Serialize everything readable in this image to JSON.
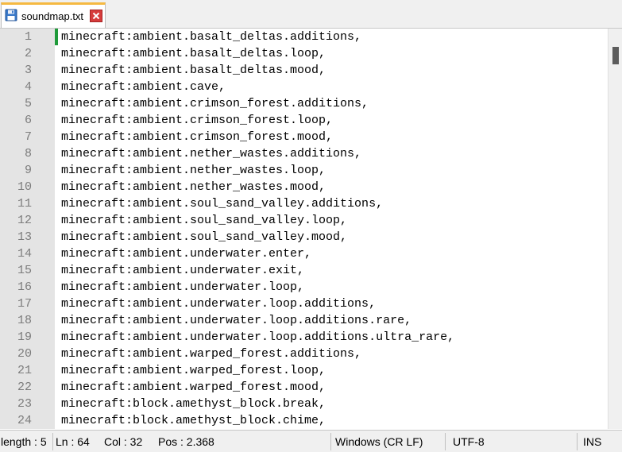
{
  "tab": {
    "filename": "soundmap.txt",
    "icon": "save-disk-icon",
    "close_icon": "close-icon"
  },
  "editor": {
    "lines": [
      {
        "n": "1",
        "text": "minecraft:ambient.basalt_deltas.additions,"
      },
      {
        "n": "2",
        "text": "minecraft:ambient.basalt_deltas.loop,"
      },
      {
        "n": "3",
        "text": "minecraft:ambient.basalt_deltas.mood,"
      },
      {
        "n": "4",
        "text": "minecraft:ambient.cave,"
      },
      {
        "n": "5",
        "text": "minecraft:ambient.crimson_forest.additions,"
      },
      {
        "n": "6",
        "text": "minecraft:ambient.crimson_forest.loop,"
      },
      {
        "n": "7",
        "text": "minecraft:ambient.crimson_forest.mood,"
      },
      {
        "n": "8",
        "text": "minecraft:ambient.nether_wastes.additions,"
      },
      {
        "n": "9",
        "text": "minecraft:ambient.nether_wastes.loop,"
      },
      {
        "n": "10",
        "text": "minecraft:ambient.nether_wastes.mood,"
      },
      {
        "n": "11",
        "text": "minecraft:ambient.soul_sand_valley.additions,"
      },
      {
        "n": "12",
        "text": "minecraft:ambient.soul_sand_valley.loop,"
      },
      {
        "n": "13",
        "text": "minecraft:ambient.soul_sand_valley.mood,"
      },
      {
        "n": "14",
        "text": "minecraft:ambient.underwater.enter,"
      },
      {
        "n": "15",
        "text": "minecraft:ambient.underwater.exit,"
      },
      {
        "n": "16",
        "text": "minecraft:ambient.underwater.loop,"
      },
      {
        "n": "17",
        "text": "minecraft:ambient.underwater.loop.additions,"
      },
      {
        "n": "18",
        "text": "minecraft:ambient.underwater.loop.additions.rare,"
      },
      {
        "n": "19",
        "text": "minecraft:ambient.underwater.loop.additions.ultra_rare,"
      },
      {
        "n": "20",
        "text": "minecraft:ambient.warped_forest.additions,"
      },
      {
        "n": "21",
        "text": "minecraft:ambient.warped_forest.loop,"
      },
      {
        "n": "22",
        "text": "minecraft:ambient.warped_forest.mood,"
      },
      {
        "n": "23",
        "text": "minecraft:block.amethyst_block.break,"
      },
      {
        "n": "24",
        "text": "minecraft:block.amethyst_block.chime,"
      }
    ]
  },
  "status": {
    "length": "length : 5",
    "ln": "Ln : 64",
    "col": "Col : 32",
    "pos": "Pos : 2.368",
    "eol": "Windows (CR LF)",
    "encoding": "UTF-8",
    "mode": "INS"
  },
  "colors": {
    "change_marker": "#1f9a3a",
    "gutter": "#e4e4e4",
    "tab_accent": "#f5b942"
  }
}
